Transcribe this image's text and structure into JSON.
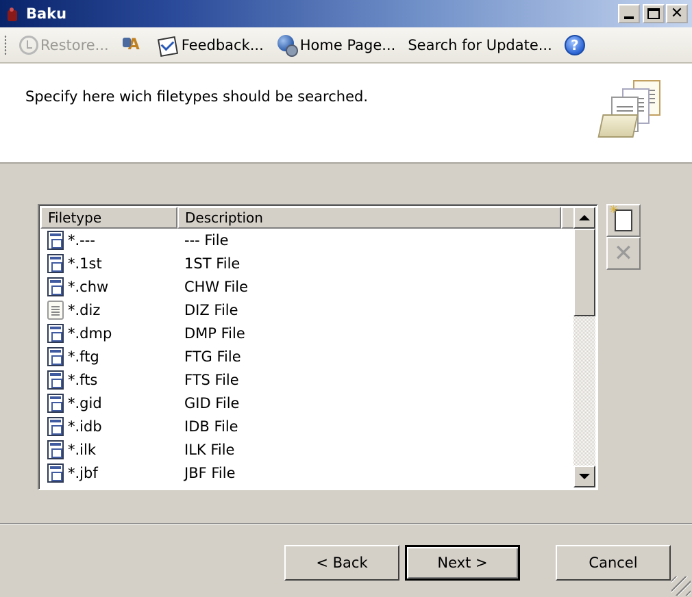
{
  "window": {
    "title": "Baku"
  },
  "toolbar": {
    "restore_label": "Restore...",
    "feedback_label": "Feedback...",
    "homepage_label": "Home Page...",
    "search_updates_label": "Search for Update...",
    "help_symbol": "?"
  },
  "header": {
    "text": "Specify here wich filetypes should be searched."
  },
  "list": {
    "columns": [
      "Filetype",
      "Description"
    ],
    "rows": [
      {
        "ext": "*.---",
        "desc": "--- File",
        "icon": "executable-file-icon"
      },
      {
        "ext": "*.1st",
        "desc": "1ST File",
        "icon": "executable-file-icon"
      },
      {
        "ext": "*.chw",
        "desc": "CHW File",
        "icon": "executable-file-icon"
      },
      {
        "ext": "*.diz",
        "desc": "DIZ File",
        "icon": "notepad-file-icon"
      },
      {
        "ext": "*.dmp",
        "desc": "DMP File",
        "icon": "executable-file-icon"
      },
      {
        "ext": "*.ftg",
        "desc": "FTG File",
        "icon": "executable-file-icon"
      },
      {
        "ext": "*.fts",
        "desc": "FTS File",
        "icon": "executable-file-icon"
      },
      {
        "ext": "*.gid",
        "desc": "GID File",
        "icon": "executable-file-icon"
      },
      {
        "ext": "*.idb",
        "desc": "IDB File",
        "icon": "executable-file-icon"
      },
      {
        "ext": "*.ilk",
        "desc": "ILK File",
        "icon": "executable-file-icon"
      },
      {
        "ext": "*.jbf",
        "desc": "JBF File",
        "icon": "executable-file-icon"
      }
    ]
  },
  "buttons": {
    "back": "< Back",
    "next": "Next >",
    "cancel": "Cancel"
  }
}
